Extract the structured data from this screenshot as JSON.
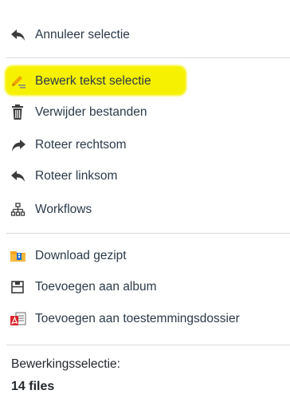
{
  "menu": {
    "items": [
      {
        "label": "Annuleer selectie",
        "icon": "undo-arrow-icon"
      },
      {
        "label": "Bewerk tekst selectie",
        "icon": "edit-pencil-icon"
      },
      {
        "label": "Verwijder bestanden",
        "icon": "trash-icon"
      },
      {
        "label": "Roteer rechtsom",
        "icon": "rotate-right-arrow-icon"
      },
      {
        "label": "Roteer linksom",
        "icon": "rotate-left-arrow-icon"
      },
      {
        "label": "Workflows",
        "icon": "workflow-hierarchy-icon"
      },
      {
        "label": "Download gezipt",
        "icon": "zip-folder-icon"
      },
      {
        "label": "Toevoegen aan album",
        "icon": "save-disk-icon"
      },
      {
        "label": "Toevoegen aan toestemmingsdossier",
        "icon": "pdf-document-icon"
      }
    ]
  },
  "selection": {
    "label": "Bewerkingsselectie:",
    "count": "14 files"
  },
  "colors": {
    "highlight": "#f6f100",
    "text": "#2b3a4a",
    "icon_dark": "#3c3c3c",
    "pencil_orange": "#f0a500",
    "zip_orange": "#f5a623",
    "pdf_red": "#d9262c",
    "divider": "#dcdcdc"
  }
}
